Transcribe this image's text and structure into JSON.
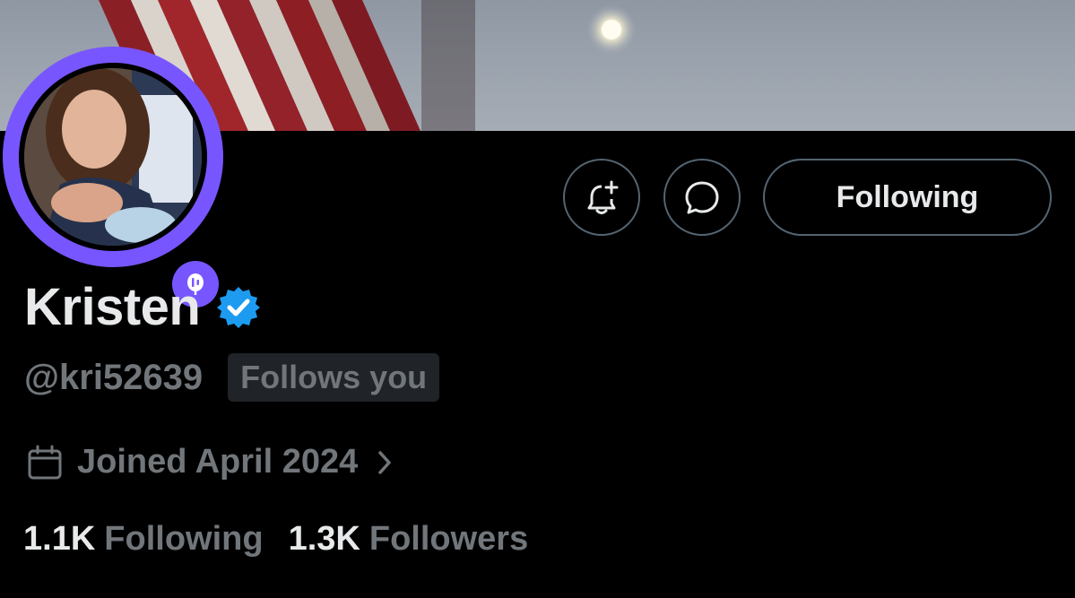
{
  "profile": {
    "display_name": "Kristen",
    "handle": "@kri52639",
    "follows_you": "Follows you",
    "joined": "Joined April 2024",
    "following_count": "1.1K",
    "following_label": "Following",
    "followers_count": "1.3K",
    "followers_label": "Followers"
  },
  "actions": {
    "follow_button_label": "Following",
    "notify_icon": "bell-plus-icon",
    "message_icon": "message-icon"
  },
  "colors": {
    "accent_purple": "#7856ff",
    "verified_blue": "#1d9bf0",
    "muted_text": "#71767b",
    "border": "#536471"
  }
}
